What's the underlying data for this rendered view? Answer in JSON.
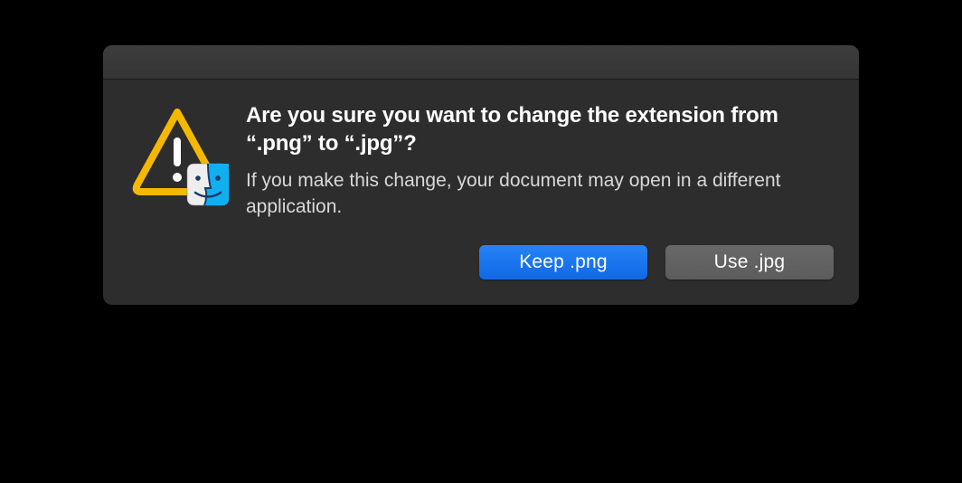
{
  "dialog": {
    "title": "Are you sure you want to change the extension from “.png” to “.jpg”?",
    "message": "If you make this change, your document may open in a different application.",
    "buttons": {
      "primary": "Keep .png",
      "secondary": "Use .jpg"
    }
  },
  "icons": {
    "alert": "warning-triangle-icon",
    "app_badge": "finder-icon"
  },
  "colors": {
    "dialog_background": "#2d2d2d",
    "primary_button": "#1f73ee",
    "secondary_button": "#616161",
    "warning_fill": "#f5b800",
    "finder_blue": "#10aff0"
  }
}
